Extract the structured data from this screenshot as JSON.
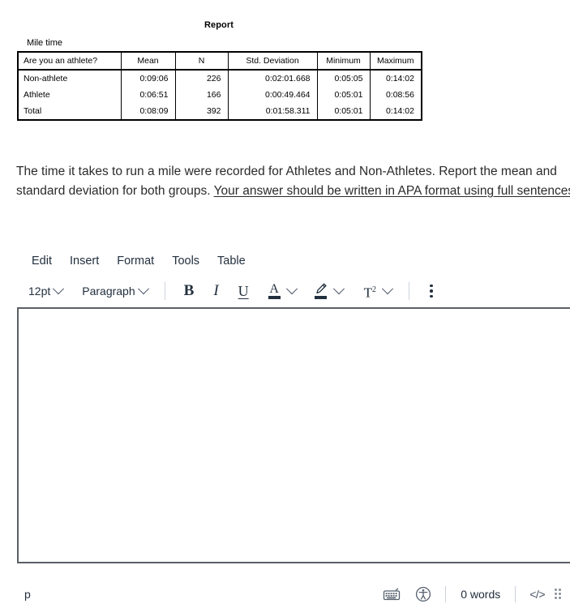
{
  "spss": {
    "report_title": "Report",
    "table_caption": "Mile time",
    "columns": [
      "Are you an athlete?",
      "Mean",
      "N",
      "Std. Deviation",
      "Minimum",
      "Maximum"
    ],
    "rows": [
      {
        "label": "Non-athlete",
        "mean": "0:09:06",
        "n": "226",
        "sd": "0:02:01.668",
        "min": "0:05:05",
        "max": "0:14:02"
      },
      {
        "label": "Athlete",
        "mean": "0:06:51",
        "n": "166",
        "sd": "0:00:49.464",
        "min": "0:05:01",
        "max": "0:08:56"
      },
      {
        "label": "Total",
        "mean": "0:08:09",
        "n": "392",
        "sd": "0:01:58.311",
        "min": "0:05:01",
        "max": "0:14:02"
      }
    ]
  },
  "prompt": {
    "plain": "The time it takes to run a mile were recorded for Athletes and Non-Athletes. Report the mean and standard deviation for both groups. ",
    "underlined": "Your answer should be written in APA format using full sentences."
  },
  "editor": {
    "menubar": [
      {
        "label": "Edit"
      },
      {
        "label": "Insert"
      },
      {
        "label": "Format"
      },
      {
        "label": "Tools"
      },
      {
        "label": "Table"
      }
    ],
    "toolbar": {
      "fontsize": "12pt",
      "blockformat": "Paragraph",
      "bold": "B",
      "italic": "I",
      "underline": "U",
      "textcolor": "A",
      "superscript": "T",
      "superscript_exp": "2",
      "more_label": "Reveal or hide additional toolbar items"
    },
    "content": "",
    "statusbar": {
      "element_path": "p",
      "wordcount": "0 words",
      "source_code": "</>"
    }
  },
  "colors": {
    "text": "#222f3e",
    "muted": "#4a5568",
    "divider": "#cdd3db",
    "editor_border": "#5c5f66",
    "table_border": "#000000"
  }
}
